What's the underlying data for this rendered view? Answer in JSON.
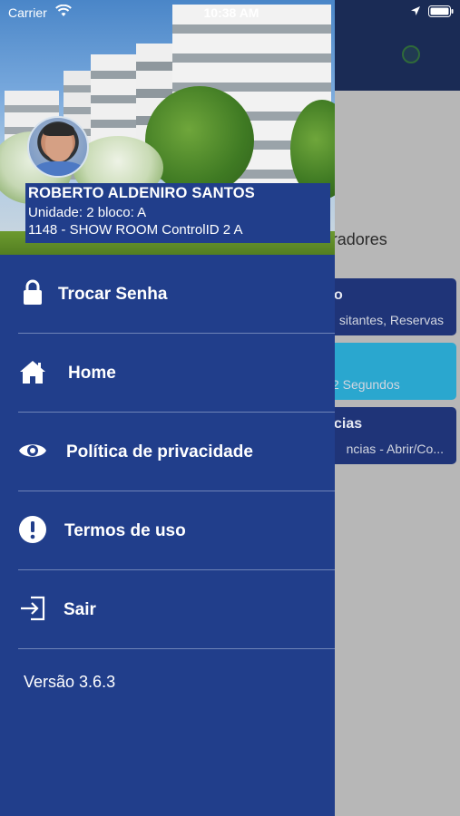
{
  "status_bar": {
    "carrier": "Carrier",
    "time": "10:38 AM",
    "icons": [
      "wifi-icon",
      "location-icon",
      "battery-icon"
    ]
  },
  "user": {
    "name": "ROBERTO ALDENIRO SANTOS",
    "unit": "Unidade: 2 bloco: A",
    "condominium": "1148 - SHOW ROOM ControlID 2 A"
  },
  "menu": [
    {
      "label": "Trocar Senha",
      "icon": "lock-icon"
    },
    {
      "label": "Home",
      "icon": "home-icon"
    },
    {
      "label": "Política de privacidade",
      "icon": "eye-icon"
    },
    {
      "label": "Termos de uso",
      "icon": "exclamation-icon"
    },
    {
      "label": "Sair",
      "icon": "logout-icon"
    }
  ],
  "version": "Versão 3.6.3",
  "background": {
    "title": "APP Moradores",
    "cards": [
      {
        "title": "o",
        "subtitle": "sitantes, Reservas"
      },
      {
        "title": "",
        "subtitle": "2 Segundos"
      },
      {
        "title": "cias",
        "subtitle": "ncias - Abrir/Co..."
      }
    ]
  },
  "colors": {
    "drawer": "#213e8b",
    "navbar": "#1a2b55",
    "card_dark": "#1f3478",
    "card_light": "#2aa7cf",
    "divider": "#6f84b8"
  }
}
